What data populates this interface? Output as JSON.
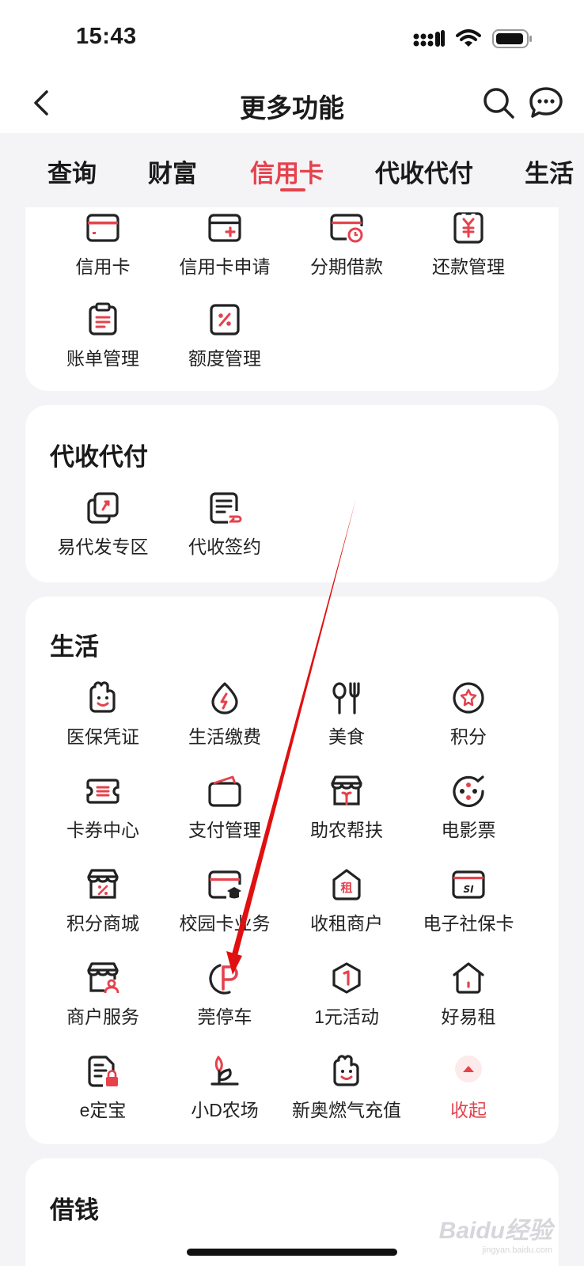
{
  "status": {
    "time": "15:43"
  },
  "nav": {
    "title": "更多功能"
  },
  "tabs": [
    {
      "label": "查询"
    },
    {
      "label": "财富"
    },
    {
      "label": "信用卡"
    },
    {
      "label": "代收代付"
    },
    {
      "label": "生活"
    }
  ],
  "credit_card_section": {
    "items": [
      {
        "label": "信用卡",
        "icon": "credit-card-icon"
      },
      {
        "label": "信用卡申请",
        "icon": "card-apply-icon"
      },
      {
        "label": "分期借款",
        "icon": "installment-icon"
      },
      {
        "label": "还款管理",
        "icon": "repayment-icon"
      },
      {
        "label": "账单管理",
        "icon": "bill-icon"
      },
      {
        "label": "额度管理",
        "icon": "limit-icon"
      }
    ]
  },
  "collect_pay_section": {
    "title": "代收代付",
    "items": [
      {
        "label": "易代发专区",
        "icon": "payroll-icon"
      },
      {
        "label": "代收签约",
        "icon": "contract-icon"
      }
    ]
  },
  "life_section": {
    "title": "生活",
    "items": [
      {
        "label": "医保凭证",
        "icon": "medical-icon"
      },
      {
        "label": "生活缴费",
        "icon": "utility-icon"
      },
      {
        "label": "美食",
        "icon": "food-icon"
      },
      {
        "label": "积分",
        "icon": "points-icon"
      },
      {
        "label": "卡券中心",
        "icon": "coupon-icon"
      },
      {
        "label": "支付管理",
        "icon": "wallet-icon"
      },
      {
        "label": "助农帮扶",
        "icon": "farm-aid-icon"
      },
      {
        "label": "电影票",
        "icon": "movie-icon"
      },
      {
        "label": "积分商城",
        "icon": "points-mall-icon"
      },
      {
        "label": "校园卡业务",
        "icon": "campus-card-icon"
      },
      {
        "label": "收租商户",
        "icon": "rent-merchant-icon"
      },
      {
        "label": "电子社保卡",
        "icon": "social-security-icon"
      },
      {
        "label": "商户服务",
        "icon": "merchant-icon"
      },
      {
        "label": "莞停车",
        "icon": "parking-icon"
      },
      {
        "label": "1元活动",
        "icon": "one-yuan-icon"
      },
      {
        "label": "好易租",
        "icon": "house-icon"
      },
      {
        "label": "e定宝",
        "icon": "lock-doc-icon"
      },
      {
        "label": "小D农场",
        "icon": "sprout-icon"
      },
      {
        "label": "新奥燃气充值",
        "icon": "gas-icon"
      }
    ],
    "collapse_label": "收起"
  },
  "borrow_section": {
    "title": "借钱"
  },
  "watermark": {
    "text": "Baidu经验",
    "sub": "jingyan.baidu.com"
  },
  "colors": {
    "accent": "#e5424d",
    "text": "#1a1a1a",
    "background": "#f4f4f6"
  }
}
